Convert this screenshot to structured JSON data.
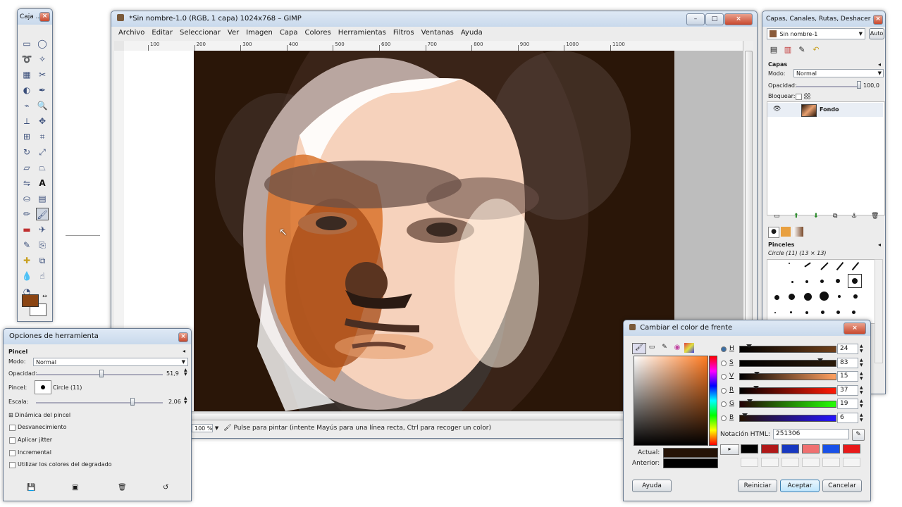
{
  "toolbox": {
    "title": "Caja ..."
  },
  "image_window": {
    "title": "*Sin nombre-1.0 (RGB, 1 capa) 1024x768 – GIMP",
    "menus": [
      "Archivo",
      "Editar",
      "Seleccionar",
      "Ver",
      "Imagen",
      "Capa",
      "Colores",
      "Herramientas",
      "Filtros",
      "Ventanas",
      "Ayuda"
    ],
    "ruler_labels": [
      "100",
      "200",
      "300",
      "400",
      "500",
      "600",
      "700",
      "800",
      "900",
      "1000",
      "1100"
    ],
    "zoom": "100 %",
    "status": "Pulse para pintar (intente Mayús para una línea recta, Ctrl para recoger un color)"
  },
  "tool_options": {
    "title": "Opciones de herramienta",
    "tool_name": "Pincel",
    "mode_label": "Modo:",
    "mode_value": "Normal",
    "opacity_label": "Opacidad:",
    "opacity_value": "51,9",
    "brush_label": "Pincel:",
    "brush_value": "Circle (11)",
    "scale_label": "Escala:",
    "scale_value": "2,06",
    "dynamics_label": "Dinámica del pincel",
    "options": [
      "Desvanecimiento",
      "Aplicar jitter",
      "Incremental",
      "Utilizar los colores del degradado"
    ]
  },
  "layers_dock": {
    "title": "Capas, Canales, Rutas, Deshacer - ...",
    "image_select": "Sin nombre-1",
    "auto_button": "Auto",
    "section_title": "Capas",
    "mode_label": "Modo:",
    "mode_value": "Normal",
    "opacity_label": "Opacidad:",
    "opacity_value": "100,0",
    "lock_label": "Bloquear:",
    "layer_name": "Fondo",
    "brushes_title": "Pinceles",
    "brushes_subtitle": "Circle (11) (13 × 13)"
  },
  "color_dialog": {
    "title": "Cambiar el color de frente",
    "channels": [
      {
        "key": "H",
        "value": "24",
        "level": 0.07,
        "gradient": "linear-gradient(90deg,#000,#70401a)"
      },
      {
        "key": "S",
        "value": "83",
        "level": 0.83,
        "gradient": "linear-gradient(90deg,#000,#2a1a0a)"
      },
      {
        "key": "V",
        "value": "15",
        "level": 0.15,
        "gradient": "linear-gradient(90deg,#000,#ffa060)"
      },
      {
        "key": "R",
        "value": "37",
        "level": 0.145,
        "gradient": "linear-gradient(90deg,#000,#ff1a06)"
      },
      {
        "key": "G",
        "value": "19",
        "level": 0.075,
        "gradient": "linear-gradient(90deg,#250006,#25ff06)"
      },
      {
        "key": "B",
        "value": "6",
        "level": 0.024,
        "gradient": "linear-gradient(90deg,#251300,#2513ff)"
      }
    ],
    "html_label": "Notación HTML:",
    "html_value": "251306",
    "current_label": "Actual:",
    "previous_label": "Anterior:",
    "history_colors": [
      "#000000",
      "#b01818",
      "#1838c0",
      "#f07070",
      "#1850e8",
      "#e81818"
    ],
    "buttons": {
      "help": "Ayuda",
      "reset": "Reiniciar",
      "ok": "Aceptar",
      "cancel": "Cancelar"
    }
  },
  "colors": {
    "foreground": "#8b4513",
    "current": "#251306",
    "previous": "#000000"
  }
}
